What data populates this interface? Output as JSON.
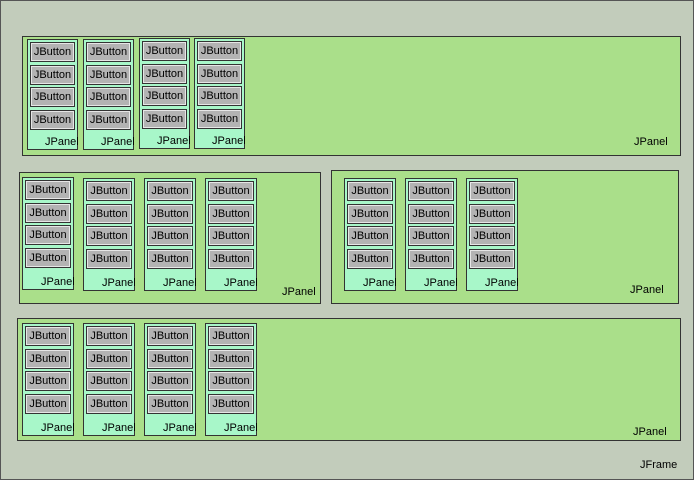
{
  "frame": {
    "label": "JFrame"
  },
  "labels": {
    "panel": "JPanel",
    "button": "JButton"
  },
  "colors": {
    "frame_bg": "#c2ccbb",
    "panel_bg": "#aadf8a",
    "subpanel_bg": "#a8f7c9",
    "button_bg": "#b3b3b3",
    "border": "#333333"
  },
  "rows": [
    {
      "panels": [
        {
          "label": "JPanel",
          "subpanels": 4,
          "buttons_per_subpanel": 4
        }
      ]
    },
    {
      "panels": [
        {
          "label": "JPanel",
          "subpanels": 4,
          "buttons_per_subpanel": 4
        },
        {
          "label": "JPanel",
          "subpanels": 3,
          "buttons_per_subpanel": 4
        }
      ]
    },
    {
      "panels": [
        {
          "label": "JPanel",
          "subpanels": 4,
          "buttons_per_subpanel": 4
        }
      ]
    }
  ]
}
